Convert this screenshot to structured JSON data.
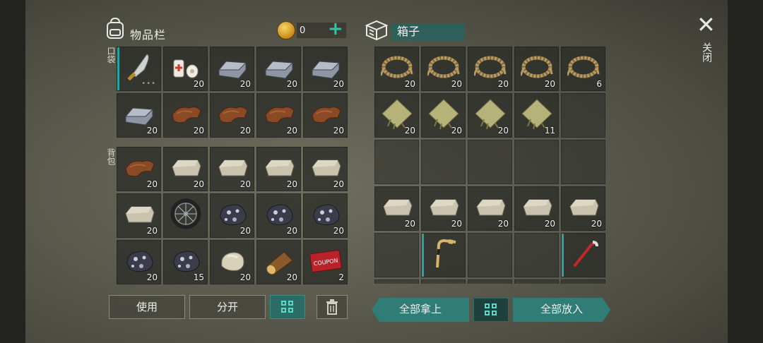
{
  "inventory": {
    "title": "物品栏",
    "coins": "0",
    "add_symbol": "+",
    "pocket_label": "口袋",
    "backpack_label": "背包",
    "pocket_items": [
      {
        "item": "machete",
        "count": ""
      },
      {
        "item": "bandage",
        "count": "20"
      },
      {
        "item": "iron-ingot",
        "count": "20"
      },
      {
        "item": "iron-ingot",
        "count": "20"
      },
      {
        "item": "iron-ingot",
        "count": "20"
      },
      {
        "item": "iron-ingot",
        "count": "20"
      },
      {
        "item": "leather",
        "count": "20"
      },
      {
        "item": "leather",
        "count": "20"
      },
      {
        "item": "leather",
        "count": "20"
      },
      {
        "item": "leather",
        "count": "20"
      }
    ],
    "backpack_items": [
      {
        "item": "leather",
        "count": "20"
      },
      {
        "item": "stone-brick",
        "count": "20"
      },
      {
        "item": "stone-brick",
        "count": "20"
      },
      {
        "item": "stone-brick",
        "count": "20"
      },
      {
        "item": "stone-brick",
        "count": "20"
      },
      {
        "item": "stone-brick",
        "count": "20"
      },
      {
        "item": "wheel",
        "count": ""
      },
      {
        "item": "iron-ore",
        "count": "20"
      },
      {
        "item": "iron-ore",
        "count": "20"
      },
      {
        "item": "iron-ore",
        "count": "20"
      },
      {
        "item": "iron-ore",
        "count": "20"
      },
      {
        "item": "iron-ore",
        "count": "15"
      },
      {
        "item": "stone",
        "count": "20"
      },
      {
        "item": "log",
        "count": "20"
      },
      {
        "item": "coupon",
        "count": "2"
      }
    ]
  },
  "box": {
    "title": "箱子",
    "items": [
      {
        "item": "rope",
        "count": "20"
      },
      {
        "item": "rope",
        "count": "20"
      },
      {
        "item": "rope",
        "count": "20"
      },
      {
        "item": "rope",
        "count": "20"
      },
      {
        "item": "rope",
        "count": "6"
      },
      {
        "item": "cloth",
        "count": "20"
      },
      {
        "item": "cloth",
        "count": "20"
      },
      {
        "item": "cloth",
        "count": "20"
      },
      {
        "item": "cloth",
        "count": "11"
      },
      {
        "item": "",
        "count": ""
      },
      {
        "item": "",
        "count": ""
      },
      {
        "item": "",
        "count": ""
      },
      {
        "item": "",
        "count": ""
      },
      {
        "item": "",
        "count": ""
      },
      {
        "item": "",
        "count": ""
      },
      {
        "item": "stone-brick",
        "count": "20"
      },
      {
        "item": "stone-brick",
        "count": "20"
      },
      {
        "item": "stone-brick",
        "count": "20"
      },
      {
        "item": "stone-brick",
        "count": "20"
      },
      {
        "item": "stone-brick",
        "count": "20"
      },
      {
        "item": "",
        "count": ""
      },
      {
        "item": "hockey-stick",
        "count": ""
      },
      {
        "item": "",
        "count": ""
      },
      {
        "item": "",
        "count": ""
      },
      {
        "item": "crowbar",
        "count": ""
      },
      {
        "item": "",
        "count": ""
      },
      {
        "item": "",
        "count": ""
      },
      {
        "item": "",
        "count": ""
      },
      {
        "item": "",
        "count": ""
      },
      {
        "item": "",
        "count": ""
      }
    ]
  },
  "close": {
    "symbol": "✕",
    "label": "关闭"
  },
  "buttons": {
    "use": "使用",
    "split": "分开",
    "take_all": "全部拿上",
    "put_all": "全部放入"
  },
  "coupon_text": "COUPON",
  "colors": {
    "accent": "#2aa4a0",
    "teal_button": "#2f7d76",
    "title_bg": "#2d5f5b"
  }
}
